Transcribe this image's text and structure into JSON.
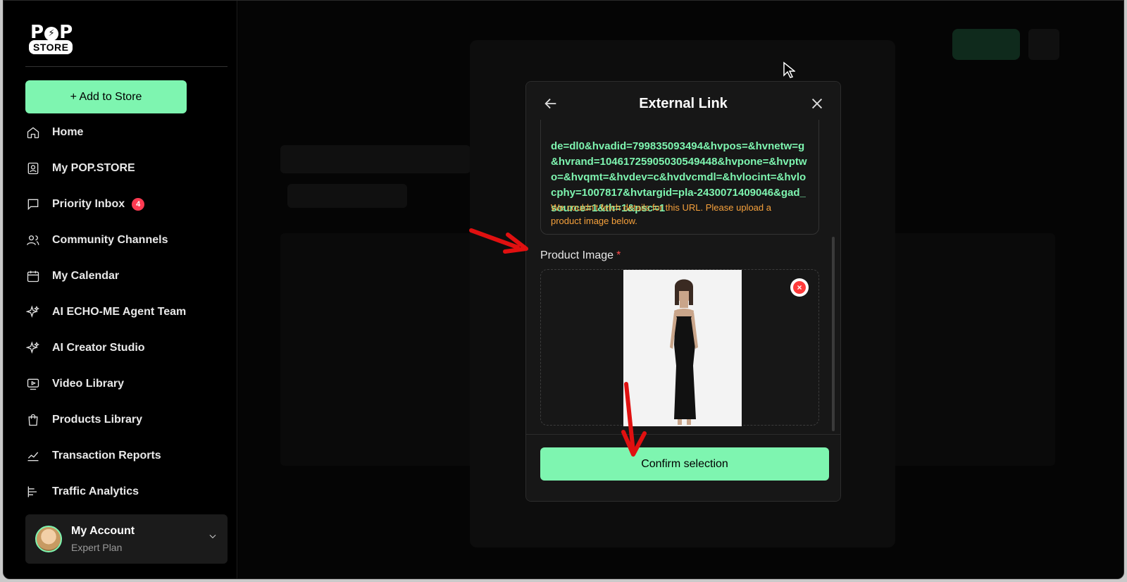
{
  "sidebar": {
    "logo": {
      "top": "POP",
      "bottom": "STORE"
    },
    "add_button": "+ Add to Store",
    "items": [
      {
        "label": "Home",
        "icon": "home-icon"
      },
      {
        "label": "My POP.STORE",
        "icon": "user-card-icon"
      },
      {
        "label": "Priority Inbox",
        "icon": "chat-icon",
        "badge": "4"
      },
      {
        "label": "Community Channels",
        "icon": "users-icon"
      },
      {
        "label": "My Calendar",
        "icon": "calendar-icon"
      },
      {
        "label": "AI ECHO-ME Agent Team",
        "icon": "sparkle-icon"
      },
      {
        "label": "AI Creator Studio",
        "icon": "sparkle-icon"
      },
      {
        "label": "Video Library",
        "icon": "video-icon"
      },
      {
        "label": "Products Library",
        "icon": "bag-icon"
      },
      {
        "label": "Transaction Reports",
        "icon": "trend-icon"
      },
      {
        "label": "Traffic Analytics",
        "icon": "bars-icon"
      }
    ],
    "account": {
      "name": "My Account",
      "plan": "Expert Plan"
    }
  },
  "modal": {
    "title": "External Link",
    "url_text": "de=dl0&hvadid=799835093494&hvpos=&hvnetw=g&hvrand=10461725905030549448&hvpone=&hvptwo=&hvqmt=&hvdev=c&hvdvcmdl=&hvlocint=&hvlocphy=1007817&hvtargid=pla-2430071409046&gad_source=1&th=1&psc=1",
    "warning": "We couldn't fetch details for this URL. Please upload a product image below.",
    "product_image_label": "Product Image",
    "required_mark": "*",
    "confirm_label": "Confirm selection"
  },
  "colors": {
    "accent": "#7ef5b0",
    "warning": "#f7a23c",
    "required": "#ff4b4b",
    "badge": "#ff3b52"
  }
}
